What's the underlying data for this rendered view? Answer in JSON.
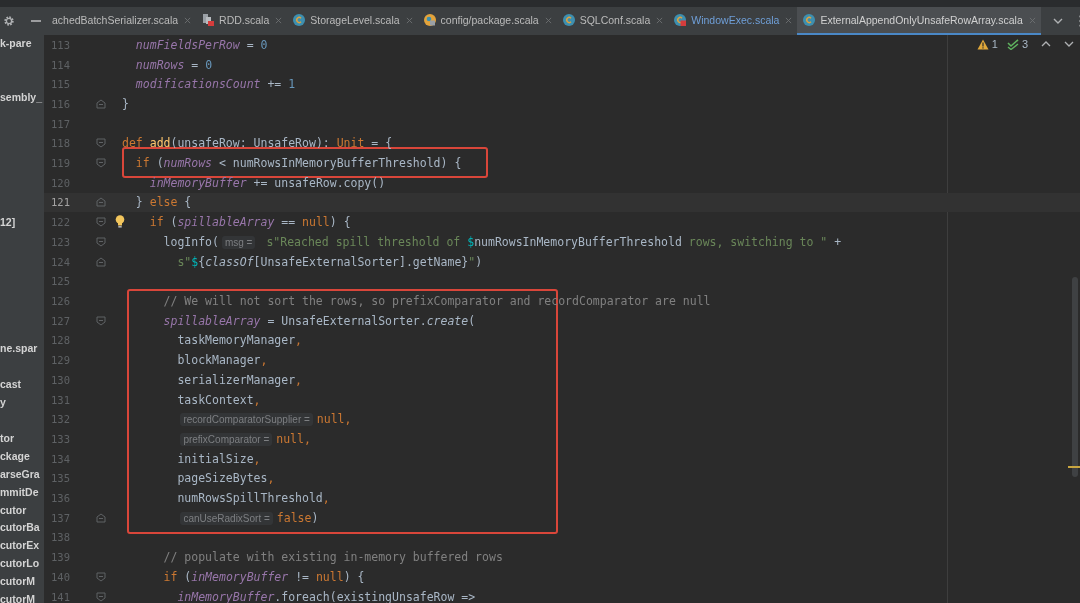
{
  "toolbar": {
    "tabs": [
      {
        "label": "achedBatchSerializer.scala",
        "kind": "none",
        "selected": false,
        "modified": false
      },
      {
        "label": "RDD.scala",
        "kind": "blocks",
        "selected": false,
        "modified": false
      },
      {
        "label": "StorageLevel.scala",
        "kind": "class",
        "selected": false,
        "modified": false
      },
      {
        "label": "config/package.scala",
        "kind": "package",
        "selected": false,
        "modified": false
      },
      {
        "label": "SQLConf.scala",
        "kind": "class",
        "selected": false,
        "modified": false
      },
      {
        "label": "WindowExec.scala",
        "kind": "error",
        "selected": false,
        "modified": true
      },
      {
        "label": "ExternalAppendOnlyUnsafeRowArray.scala",
        "kind": "class",
        "selected": true,
        "modified": false
      }
    ]
  },
  "sidebar": {
    "items": [
      "k-pare",
      "sembly_",
      "12]",
      "ne.spar",
      "cast",
      "y",
      "tor",
      "ckage",
      "arseGra",
      "mmitDe",
      "cutor",
      "cutorBa",
      "cutorEx",
      "cutorLo",
      "cutorM",
      "cutorM"
    ]
  },
  "inspections": {
    "warnings": "1",
    "weak_warnings": "3"
  },
  "editor": {
    "lines": [
      {
        "kind": "code",
        "number": "113",
        "current": false,
        "tokens": [
          {
            "kind": "field",
            "text": "  numFieldsPerRow"
          },
          {
            "kind": "plain",
            "text": " = "
          },
          {
            "kind": "num",
            "text": "0"
          }
        ]
      },
      {
        "kind": "code",
        "number": "114",
        "current": false,
        "tokens": [
          {
            "kind": "field",
            "text": "  numRows"
          },
          {
            "kind": "plain",
            "text": " = "
          },
          {
            "kind": "num",
            "text": "0"
          }
        ]
      },
      {
        "kind": "code",
        "number": "115",
        "current": false,
        "tokens": [
          {
            "kind": "field",
            "text": "  modificationsCount"
          },
          {
            "kind": "plain",
            "text": " += "
          },
          {
            "kind": "num",
            "text": "1"
          }
        ]
      },
      {
        "kind": "closer",
        "number": "116",
        "current": false,
        "tokens": [
          {
            "kind": "plain",
            "text": "}"
          }
        ]
      },
      {
        "kind": "code",
        "number": "117",
        "current": false
      },
      {
        "kind": "opener",
        "number": "118",
        "current": false,
        "tokens": [
          {
            "kind": "kw",
            "text": "def "
          },
          {
            "kind": "fn",
            "text": "add"
          },
          {
            "kind": "plain",
            "text": "(unsafeRow: UnsafeRow): "
          },
          {
            "kind": "kw",
            "text": "Unit"
          },
          {
            "kind": "plain",
            "text": " = {"
          }
        ]
      },
      {
        "kind": "annotation",
        "lines": [
          {
            "kind": "opener",
            "number": "119",
            "current": false,
            "tokens": [
              {
                "kind": "kw",
                "text": "  if "
              },
              {
                "kind": "plain",
                "text": "("
              },
              {
                "kind": "field",
                "text": "numRows"
              },
              {
                "kind": "plain",
                "text": " < numRowsInMemoryBufferThreshold) {"
              }
            ]
          }
        ]
      },
      {
        "kind": "code",
        "number": "120",
        "current": false,
        "tokens": [
          {
            "kind": "field",
            "text": "    inMemoryBuffer"
          },
          {
            "kind": "plain",
            "text": " += unsafeRow.copy()"
          }
        ]
      },
      {
        "kind": "closer",
        "number": "121",
        "current": true,
        "tokens": [
          {
            "kind": "plain",
            "text": "  } "
          },
          {
            "kind": "kw",
            "text": "else"
          },
          {
            "kind": "plain",
            "text": " {"
          }
        ]
      },
      {
        "kind": "opener",
        "number": "122",
        "current": false,
        "bulb": true,
        "tokens": [
          {
            "kind": "kw",
            "text": "    if "
          },
          {
            "kind": "plain",
            "text": "("
          },
          {
            "kind": "field",
            "text": "spillableArray"
          },
          {
            "kind": "plain",
            "text": " == "
          },
          {
            "kind": "kw",
            "text": "null"
          },
          {
            "kind": "plain",
            "text": ") {"
          }
        ]
      },
      {
        "kind": "opener",
        "number": "123",
        "current": false,
        "tokens": [
          {
            "kind": "plain",
            "text": "      logInfo("
          },
          {
            "kind": "hint",
            "text": "msg ="
          },
          {
            "kind": "str",
            "text": " s\"Reached spill threshold of "
          },
          {
            "kind": "interp",
            "text": "$"
          },
          {
            "kind": "plain",
            "text": "numRowsInMemoryBufferThreshold"
          },
          {
            "kind": "str",
            "text": " rows, switching to \""
          },
          {
            "kind": "plain",
            "text": " +"
          }
        ]
      },
      {
        "kind": "closer",
        "number": "124",
        "current": false,
        "tokens": [
          {
            "kind": "str",
            "text": "        s\""
          },
          {
            "kind": "interp",
            "text": "$"
          },
          {
            "kind": "plain",
            "text": "{"
          },
          {
            "kind": "italic",
            "text": "classOf"
          },
          {
            "kind": "plain",
            "text": "[UnsafeExternalSorter].getName}"
          },
          {
            "kind": "str",
            "text": "\""
          },
          {
            "kind": "plain",
            "text": ")"
          }
        ]
      },
      {
        "kind": "code",
        "number": "125",
        "current": false
      },
      {
        "kind": "annotation",
        "lines": [
          {
            "kind": "code",
            "number": "126",
            "current": false,
            "tokens": [
              {
                "kind": "comment",
                "text": "      // We will not sort the rows, so prefixComparator and recordComparator are null"
              }
            ]
          },
          {
            "kind": "opener",
            "number": "127",
            "current": false,
            "tokens": [
              {
                "kind": "field",
                "text": "      spillableArray"
              },
              {
                "kind": "plain",
                "text": " = UnsafeExternalSorter."
              },
              {
                "kind": "italic",
                "text": "create"
              },
              {
                "kind": "plain",
                "text": "("
              }
            ]
          },
          {
            "kind": "code",
            "number": "128",
            "current": false,
            "tokens": [
              {
                "kind": "plain",
                "text": "        taskMemoryManager"
              },
              {
                "kind": "kw",
                "text": ","
              }
            ]
          },
          {
            "kind": "code",
            "number": "129",
            "current": false,
            "tokens": [
              {
                "kind": "plain",
                "text": "        blockManager"
              },
              {
                "kind": "kw",
                "text": ","
              }
            ]
          },
          {
            "kind": "code",
            "number": "130",
            "current": false,
            "tokens": [
              {
                "kind": "plain",
                "text": "        serializerManager"
              },
              {
                "kind": "kw",
                "text": ","
              }
            ]
          },
          {
            "kind": "code",
            "number": "131",
            "current": false,
            "tokens": [
              {
                "kind": "plain",
                "text": "        taskContext"
              },
              {
                "kind": "kw",
                "text": ","
              }
            ]
          },
          {
            "kind": "code",
            "number": "132",
            "current": false,
            "tokens": [
              {
                "kind": "hint",
                "text": "        recordComparatorSupplier ="
              },
              {
                "kind": "kw",
                "text": "null,"
              }
            ]
          },
          {
            "kind": "code",
            "number": "133",
            "current": false,
            "tokens": [
              {
                "kind": "hint",
                "text": "        prefixComparator ="
              },
              {
                "kind": "kw",
                "text": "null,"
              }
            ]
          },
          {
            "kind": "code",
            "number": "134",
            "current": false,
            "tokens": [
              {
                "kind": "plain",
                "text": "        initialSize"
              },
              {
                "kind": "kw",
                "text": ","
              }
            ]
          },
          {
            "kind": "code",
            "number": "135",
            "current": false,
            "tokens": [
              {
                "kind": "plain",
                "text": "        pageSizeBytes"
              },
              {
                "kind": "kw",
                "text": ","
              }
            ]
          },
          {
            "kind": "code",
            "number": "136",
            "current": false,
            "tokens": [
              {
                "kind": "plain",
                "text": "        numRowsSpillThreshold"
              },
              {
                "kind": "kw",
                "text": ","
              }
            ]
          },
          {
            "kind": "closer",
            "number": "137",
            "current": false,
            "tokens": [
              {
                "kind": "hint",
                "text": "        canUseRadixSort ="
              },
              {
                "kind": "kw",
                "text": "false"
              },
              {
                "kind": "plain",
                "text": ")"
              }
            ]
          }
        ]
      },
      {
        "kind": "code",
        "number": "138",
        "current": false
      },
      {
        "kind": "code",
        "number": "139",
        "current": false,
        "tokens": [
          {
            "kind": "comment",
            "text": "      // populate with existing in-memory buffered rows"
          }
        ]
      },
      {
        "kind": "opener",
        "number": "140",
        "current": false,
        "tokens": [
          {
            "kind": "kw",
            "text": "      if "
          },
          {
            "kind": "plain",
            "text": "("
          },
          {
            "kind": "field",
            "text": "inMemoryBuffer"
          },
          {
            "kind": "plain",
            "text": " != "
          },
          {
            "kind": "kw",
            "text": "null"
          },
          {
            "kind": "plain",
            "text": ") {"
          }
        ]
      },
      {
        "kind": "opener",
        "number": "141",
        "current": false,
        "tokens": [
          {
            "kind": "field",
            "text": "        inMemoryBuffer"
          },
          {
            "kind": "plain",
            "text": ".foreach(existingUnsafeRow =>"
          }
        ]
      }
    ]
  }
}
